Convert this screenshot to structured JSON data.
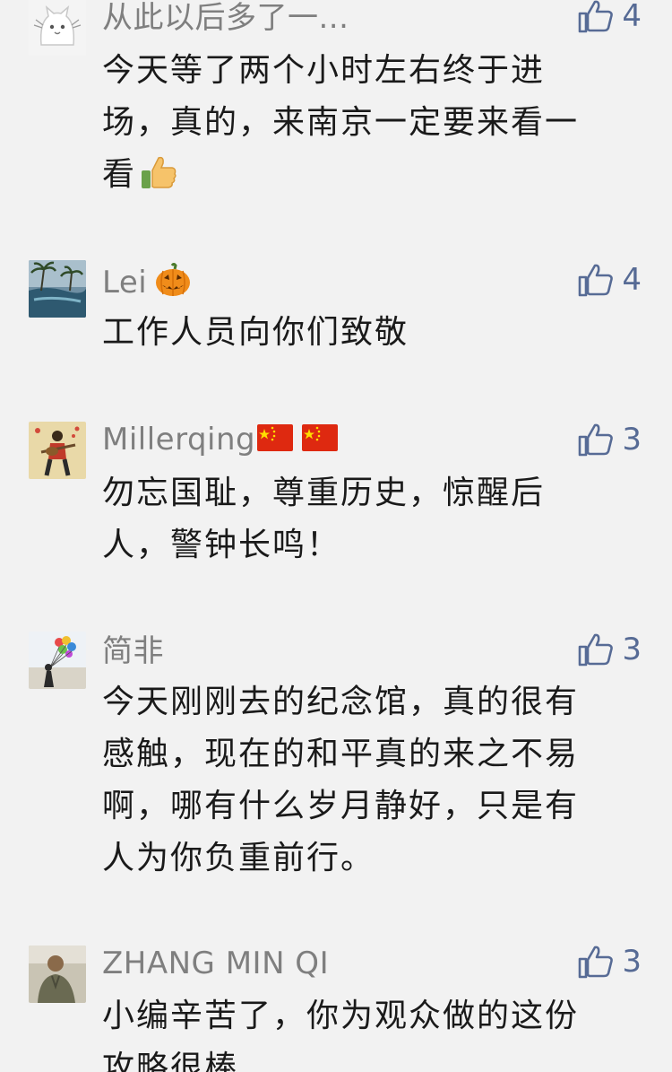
{
  "comments": [
    {
      "nickname": "从此以后多了一...",
      "likes": "4",
      "lines": [
        "今天等了两个小时左右终于进",
        "场，真的，来南京一定要来看一",
        "看"
      ],
      "avatar_icon": "white-cat-avatar",
      "trailing_emoji": "thumbs-up-emoji"
    },
    {
      "nickname": "Lei",
      "likes": "4",
      "lines": [
        "工作人员向你们致敬"
      ],
      "avatar_icon": "palm-tree-pool-avatar",
      "nickname_emoji": "jack-o-lantern-emoji"
    },
    {
      "nickname": "Millerqing",
      "likes": "3",
      "lines": [
        "勿忘国耻，尊重历史，惊醒后",
        "人，警钟长鸣！"
      ],
      "avatar_icon": "guitar-player-avatar",
      "nickname_emoji": "china-flag-emoji"
    },
    {
      "nickname": "简非",
      "likes": "3",
      "lines": [
        "今天刚刚去的纪念馆，真的很有",
        "感触，现在的和平真的来之不易",
        "啊，哪有什么岁月静好，只是有",
        "人为你负重前行。"
      ],
      "avatar_icon": "balloons-avatar"
    },
    {
      "nickname": "ZHANG MIN QI",
      "likes": "3",
      "lines": [
        "小编辛苦了，你为观众做的这份",
        "攻略很棒"
      ],
      "avatar_icon": "person-photo-avatar"
    }
  ],
  "colors": {
    "background": "#f2f2f2",
    "nickname": "#7f7f7f",
    "like": "#576b95",
    "text": "#1a1a1a"
  }
}
